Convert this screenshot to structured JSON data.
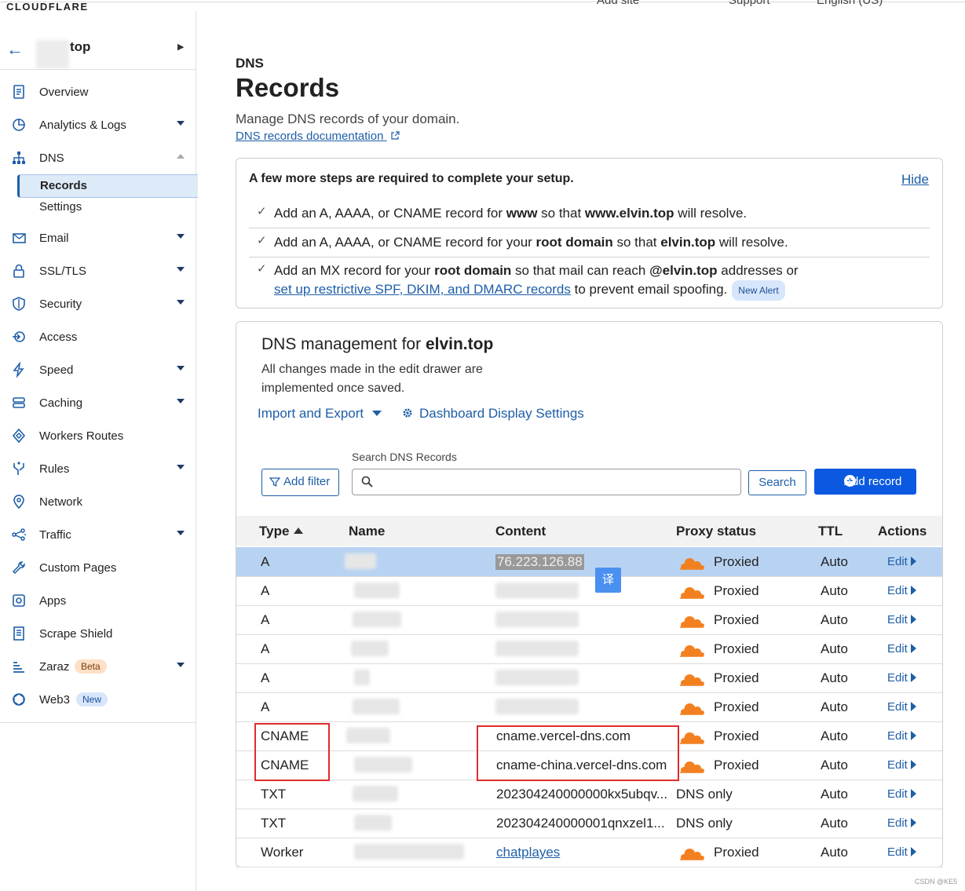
{
  "header": {
    "logo": "CLOUDFLARE",
    "nav": [
      "Add site",
      "Support",
      "English (US)"
    ]
  },
  "sidebar": {
    "domain": "top",
    "items": [
      {
        "label": "Overview",
        "icon": "document-icon",
        "caret": false
      },
      {
        "label": "Analytics & Logs",
        "icon": "chart-pie-icon",
        "caret": true
      },
      {
        "label": "DNS",
        "icon": "sitemap-icon",
        "caret": "up"
      },
      {
        "label": "Email",
        "icon": "envelope-icon",
        "caret": true
      },
      {
        "label": "SSL/TLS",
        "icon": "lock-icon",
        "caret": true
      },
      {
        "label": "Security",
        "icon": "shield-icon",
        "caret": true
      },
      {
        "label": "Access",
        "icon": "access-icon",
        "caret": false
      },
      {
        "label": "Speed",
        "icon": "lightning-icon",
        "caret": true
      },
      {
        "label": "Caching",
        "icon": "server-icon",
        "caret": true
      },
      {
        "label": "Workers Routes",
        "icon": "diamond-icon",
        "caret": false
      },
      {
        "label": "Rules",
        "icon": "rules-icon",
        "caret": true
      },
      {
        "label": "Network",
        "icon": "pin-icon",
        "caret": false
      },
      {
        "label": "Traffic",
        "icon": "traffic-icon",
        "caret": true
      },
      {
        "label": "Custom Pages",
        "icon": "wrench-icon",
        "caret": false
      },
      {
        "label": "Apps",
        "icon": "apps-icon",
        "caret": false
      },
      {
        "label": "Scrape Shield",
        "icon": "scrape-icon",
        "caret": false
      },
      {
        "label": "Zaraz",
        "icon": "zaraz-icon",
        "caret": true,
        "badge": "Beta"
      },
      {
        "label": "Web3",
        "icon": "web3-icon",
        "caret": false,
        "badge": "New"
      }
    ],
    "dns_sub": [
      "Records",
      "Settings"
    ]
  },
  "page": {
    "crumb": "DNS",
    "title": "Records",
    "description": "Manage DNS records of your domain.",
    "doc_link": "DNS records documentation"
  },
  "setup": {
    "title": "A few more steps are required to complete your setup.",
    "hide": "Hide",
    "step1": {
      "a": "Add an A, AAAA, or CNAME record for ",
      "b": "www",
      "c": " so that ",
      "d": "www.elvin.top",
      "e": " will resolve."
    },
    "step2": {
      "a": "Add an A, AAAA, or CNAME record for your ",
      "b": "root domain",
      "c": " so that ",
      "d": "elvin.top",
      "e": " will resolve."
    },
    "step3": {
      "a": "Add an MX record for your ",
      "b": "root domain",
      "c": " so that mail can reach ",
      "d": "@elvin.top",
      "e": " addresses or",
      "link": "set up restrictive SPF, DKIM, and DMARC records",
      "f": " to prevent email spoofing.",
      "badge": "New Alert"
    }
  },
  "mgmt": {
    "title_prefix": "DNS management for ",
    "title_domain": "elvin.top",
    "desc": "All changes made in the edit drawer are implemented once saved.",
    "import_export": "Import and Export",
    "display_settings": "Dashboard Display Settings",
    "search_label": "Search DNS Records",
    "add_filter": "Add filter",
    "search_button": "Search",
    "add_record": "Add record",
    "search_value": ""
  },
  "table": {
    "headers": [
      "Type",
      "Name",
      "Content",
      "Proxy status",
      "TTL",
      "Actions"
    ],
    "rows": [
      {
        "type": "A",
        "name": "",
        "content": "76.223.126.88",
        "proxy": "Proxied",
        "ttl": "Auto",
        "action": "Edit"
      },
      {
        "type": "A",
        "name": "",
        "content": "",
        "proxy": "Proxied",
        "ttl": "Auto",
        "action": "Edit"
      },
      {
        "type": "A",
        "name": "",
        "content": "",
        "proxy": "Proxied",
        "ttl": "Auto",
        "action": "Edit"
      },
      {
        "type": "A",
        "name": "",
        "content": "",
        "proxy": "Proxied",
        "ttl": "Auto",
        "action": "Edit"
      },
      {
        "type": "A",
        "name": "",
        "content": "",
        "proxy": "Proxied",
        "ttl": "Auto",
        "action": "Edit"
      },
      {
        "type": "A",
        "name": "",
        "content": "",
        "proxy": "Proxied",
        "ttl": "Auto",
        "action": "Edit"
      },
      {
        "type": "CNAME",
        "name": "",
        "content": "cname.vercel-dns.com",
        "proxy": "Proxied",
        "ttl": "Auto",
        "action": "Edit"
      },
      {
        "type": "CNAME",
        "name": "",
        "content": "cname-china.vercel-dns.com",
        "proxy": "Proxied",
        "ttl": "Auto",
        "action": "Edit"
      },
      {
        "type": "TXT",
        "name": "",
        "content": "202304240000000kx5ubqv...",
        "proxy": "DNS only",
        "ttl": "Auto",
        "action": "Edit"
      },
      {
        "type": "TXT",
        "name": "",
        "content": "202304240000001qnxzel1...",
        "proxy": "DNS only",
        "ttl": "Auto",
        "action": "Edit"
      },
      {
        "type": "Worker",
        "name": "",
        "content": "chatplayes",
        "proxy": "Proxied",
        "ttl": "Auto",
        "action": "Edit"
      }
    ]
  },
  "overlay": {
    "translate": "译",
    "watermark": "CSDN @KE5"
  },
  "colors": {
    "accent": "#1e5ea8",
    "primary_button": "#0a59e0",
    "cloud": "#f38020",
    "selected_row": "#b8d3f2",
    "highlight_box": "#e12b2b"
  }
}
